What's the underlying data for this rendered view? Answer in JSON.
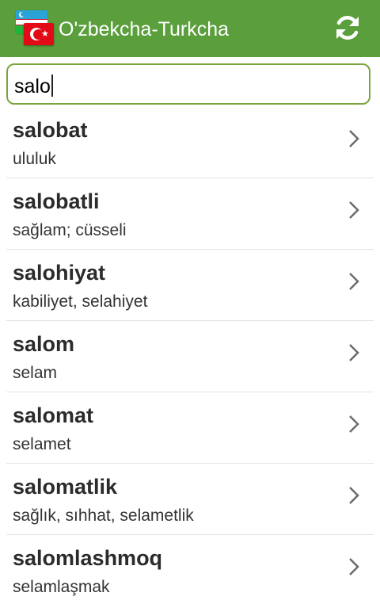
{
  "toolbar": {
    "title": "O'zbekcha-Turkcha",
    "flags_icon": "uzbek-turkish-flags-icon",
    "refresh_icon": "refresh-icon",
    "background": "#5a9f3c"
  },
  "search": {
    "value": "salo",
    "border_color": "#7ca43c"
  },
  "results": [
    {
      "word": "salobat",
      "meaning": "ululuk"
    },
    {
      "word": "salobatli",
      "meaning": "sağlam; cüsseli"
    },
    {
      "word": "salohiyat",
      "meaning": "kabiliyet, selahiyet"
    },
    {
      "word": "salom",
      "meaning": "selam"
    },
    {
      "word": "salomat",
      "meaning": "selamet"
    },
    {
      "word": "salomatlik",
      "meaning": "sağlık, sıhhat, selametlik"
    },
    {
      "word": "salomlashmoq",
      "meaning": "selamlaşmak"
    }
  ],
  "chevron_icon": "chevron-right-icon"
}
